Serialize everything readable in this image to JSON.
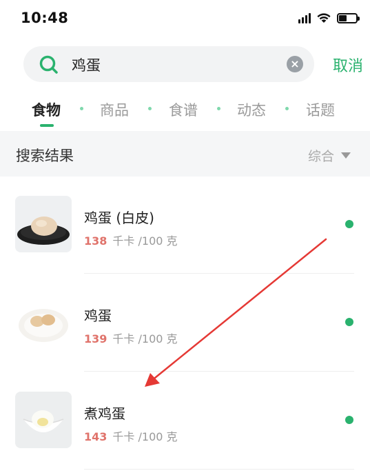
{
  "status_bar": {
    "time": "10:48"
  },
  "search": {
    "query": "鸡蛋",
    "cancel_label": "取消"
  },
  "tabs": [
    {
      "label": "食物",
      "active": true
    },
    {
      "label": "商品",
      "active": false
    },
    {
      "label": "食谱",
      "active": false
    },
    {
      "label": "动态",
      "active": false
    },
    {
      "label": "话题",
      "active": false
    }
  ],
  "results": {
    "title": "搜索结果",
    "sort_label": "综合",
    "items": [
      {
        "name": "鸡蛋 (白皮)",
        "calories": "138",
        "unit": "千卡 /100 克",
        "image": "egg-on-black-plate"
      },
      {
        "name": "鸡蛋",
        "calories": "139",
        "unit": "千卡 /100 克",
        "image": "eggs-on-white-plate"
      },
      {
        "name": "煮鸡蛋",
        "calories": "143",
        "unit": "千卡 /100 克",
        "image": "boiled-egg-in-bowl"
      }
    ]
  },
  "colors": {
    "accent": "#2ab26e",
    "calorie": "#e0736b",
    "annotation_arrow": "#e53935"
  },
  "icons": [
    "signal-icon",
    "wifi-icon",
    "battery-icon",
    "search-icon",
    "clear-icon",
    "chevron-down-icon"
  ]
}
